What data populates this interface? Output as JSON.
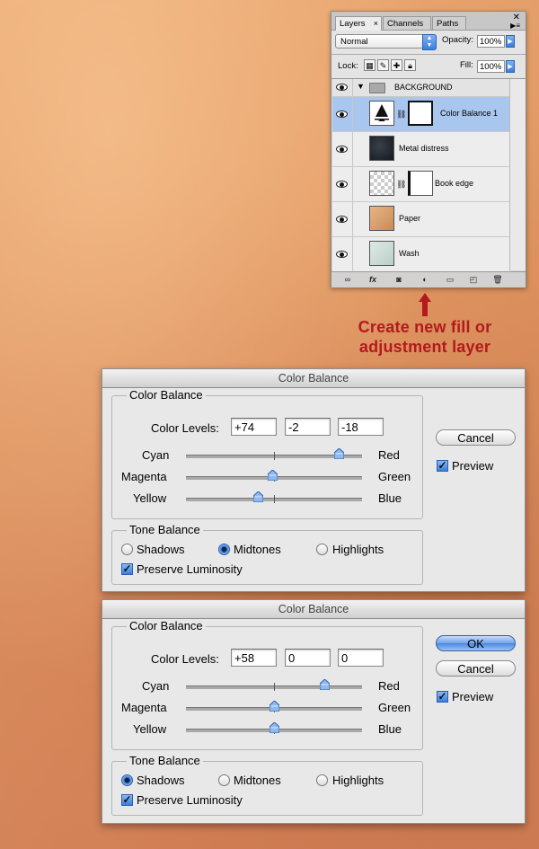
{
  "layers_panel": {
    "tabs": [
      {
        "label": "Layers",
        "close": "×"
      },
      {
        "label": "Channels"
      },
      {
        "label": "Paths"
      }
    ],
    "blend_mode": "Normal",
    "opacity_label": "Opacity:",
    "opacity_value": "100%",
    "lock_label": "Lock:",
    "fill_label": "Fill:",
    "fill_value": "100%",
    "group": {
      "name": "BACKGROUND"
    },
    "layers": [
      {
        "name": "Color Balance 1",
        "selected": true
      },
      {
        "name": "Metal distress"
      },
      {
        "name": "Book edge"
      },
      {
        "name": "Paper"
      },
      {
        "name": "Wash"
      }
    ],
    "bottom_buttons": [
      "link-icon",
      "fx-icon",
      "mask-icon",
      "adjustment-layer-icon",
      "group-folder-icon",
      "new-layer-icon",
      "trash-icon"
    ],
    "fx_label": "fx"
  },
  "annotation": {
    "text_line1": "Create new fill or",
    "text_line2": "adjustment layer",
    "color": "#b21a1e"
  },
  "dialogs": [
    {
      "title": "Color Balance",
      "group_title": "Color Balance",
      "color_levels_label": "Color Levels:",
      "levels": [
        "+74",
        "-2",
        "-18"
      ],
      "sliders": [
        {
          "left": "Cyan",
          "right": "Red",
          "value": 74
        },
        {
          "left": "Magenta",
          "right": "Green",
          "value": -2
        },
        {
          "left": "Yellow",
          "right": "Blue",
          "value": -18
        }
      ],
      "tone_title": "Tone Balance",
      "tones": [
        "Shadows",
        "Midtones",
        "Highlights"
      ],
      "selected_tone": "Midtones",
      "preserve_label": "Preserve Luminosity",
      "preserve_checked": true,
      "cancel_label": "Cancel",
      "preview_label": "Preview",
      "preview_checked": true
    },
    {
      "title": "Color Balance",
      "group_title": "Color Balance",
      "color_levels_label": "Color Levels:",
      "levels": [
        "+58",
        "0",
        "0"
      ],
      "sliders": [
        {
          "left": "Cyan",
          "right": "Red",
          "value": 58
        },
        {
          "left": "Magenta",
          "right": "Green",
          "value": 0
        },
        {
          "left": "Yellow",
          "right": "Blue",
          "value": 0
        }
      ],
      "tone_title": "Tone Balance",
      "tones": [
        "Shadows",
        "Midtones",
        "Highlights"
      ],
      "selected_tone": "Shadows",
      "preserve_label": "Preserve Luminosity",
      "preserve_checked": true,
      "ok_label": "OK",
      "cancel_label": "Cancel",
      "preview_label": "Preview",
      "preview_checked": true
    }
  ]
}
